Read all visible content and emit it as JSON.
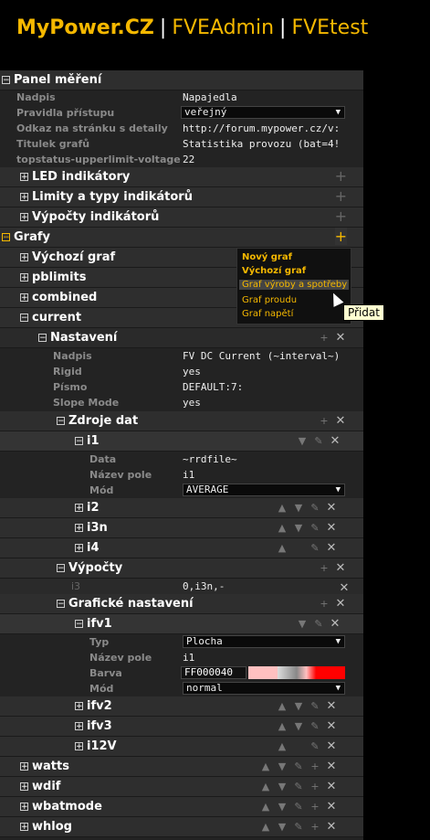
{
  "header": {
    "brand": "MyPower.CZ",
    "sep1": "|",
    "app1": "FVEAdmin",
    "sep2": "|",
    "app2": "FVEtest"
  },
  "panel_mereni": {
    "title": "Panel měření",
    "props": [
      {
        "k": "Nadpis",
        "v": "Napajedla"
      },
      {
        "k": "Pravidla přístupu",
        "v": "veřejný"
      },
      {
        "k": "Odkaz na stránku s detaily",
        "v": "http://forum.mypower.cz/v:"
      },
      {
        "k": "Titulek grafů",
        "v": "Statistika provozu (bat=4!"
      },
      {
        "k": "topstatus-upperlimit-voltage",
        "v": "22"
      }
    ]
  },
  "sections": {
    "led": "LED indikátory",
    "limity": "Limity a typy indikátorů",
    "vypocty": "Výpočty indikátorů",
    "grafy": "Grafy"
  },
  "grafy_items": {
    "vychozi": "Výchozí graf",
    "pblimits": "pblimits",
    "combined": "combined",
    "current": "current"
  },
  "nastaveni": {
    "title": "Nastavení",
    "props": [
      {
        "k": "Nadpis",
        "v": "FV DC Current (~interval~)"
      },
      {
        "k": "Rigid",
        "v": "yes"
      },
      {
        "k": "Písmo",
        "v": "DEFAULT:7:"
      },
      {
        "k": "Slope Mode",
        "v": "yes"
      }
    ]
  },
  "zdroje": {
    "title": "Zdroje dat",
    "i1": "i1",
    "i1_props": [
      {
        "k": "Data",
        "v": "~rrdfile~"
      },
      {
        "k": "Název pole",
        "v": "i1"
      },
      {
        "k": "Mód",
        "v": "AVERAGE"
      }
    ],
    "i2": "i2",
    "i3n": "i3n",
    "i4": "i4"
  },
  "vypocty2": {
    "title": "Výpočty",
    "k": "i3",
    "v": "0,i3n,-"
  },
  "graficke": {
    "title": "Grafické nastavení",
    "ifv1": "ifv1",
    "ifv1_props": [
      {
        "k": "Typ",
        "v": "Plocha"
      },
      {
        "k": "Název pole",
        "v": "i1"
      },
      {
        "k": "Barva",
        "v": "FF000040"
      },
      {
        "k": "Mód",
        "v": "normal"
      }
    ],
    "ifv2": "ifv2",
    "ifv3": "ifv3",
    "i12v": "i12V"
  },
  "bottom_items": {
    "watts": "watts",
    "wdif": "wdif",
    "wbatmode": "wbatmode",
    "whlog": "whlog"
  },
  "menu": {
    "items": [
      "Nový graf",
      "Výchozí graf",
      "Graf výroby a spotřeby",
      "Graf proudu",
      "Graf napětí"
    ]
  },
  "tooltip": "Přidat",
  "icons": {
    "plus": "+",
    "minus": "−",
    "close": "✕",
    "up": "▲",
    "down": "▼",
    "edit": "✎",
    "toggle_open": "⊟",
    "toggle_closed": "⊞"
  },
  "colors": {
    "accent": "#f5b800",
    "color_value": "#ff0000"
  }
}
